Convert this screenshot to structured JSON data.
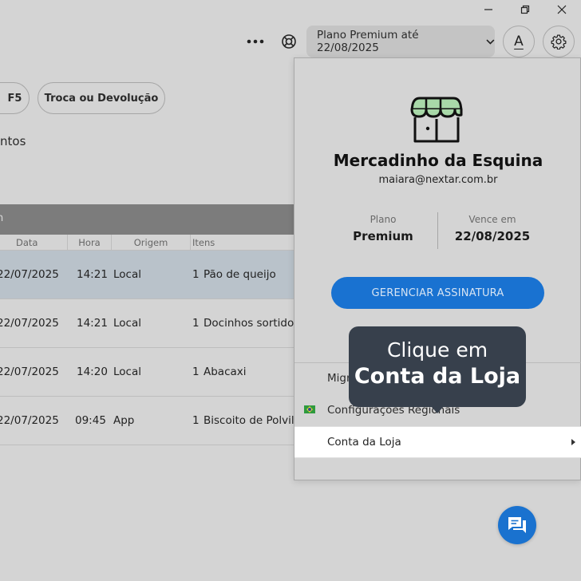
{
  "toolbar": {
    "plan_label": "Plano Premium até 22/08/2025",
    "text_size_label": "A"
  },
  "actions": {
    "f5_label": "F5",
    "exchange_label": "Troca ou Devolução"
  },
  "partial_text": "ntos",
  "table": {
    "title_fragment": "n",
    "headers": [
      "Data",
      "Hora",
      "Origem",
      "Itens"
    ],
    "rows": [
      {
        "date": "22/07/2025",
        "time": "14:21",
        "origin": "Local",
        "qty": "1",
        "item": "Pão de queijo"
      },
      {
        "date": "22/07/2025",
        "time": "14:21",
        "origin": "Local",
        "qty": "1",
        "item": "Docinhos sortidos"
      },
      {
        "date": "22/07/2025",
        "time": "14:20",
        "origin": "Local",
        "qty": "1",
        "item": "Abacaxi"
      },
      {
        "date": "22/07/2025",
        "time": "09:45",
        "origin": "App",
        "qty": "1",
        "item": "Biscoito de Polvilho"
      }
    ]
  },
  "panel": {
    "store_name": "Mercadinho da Esquina",
    "email": "maiara@nextar.com.br",
    "plan_label": "Plano",
    "plan_value": "Premium",
    "expires_label": "Vence em",
    "expires_value": "22/08/2025",
    "manage_button": "GERENCIAR ASSINATURA",
    "menu": {
      "migrate_fragment": "Migr",
      "regional_settings": "Configurações Regionais",
      "store_account": "Conta da Loja"
    }
  },
  "tooltip": {
    "line1": "Clique em",
    "line2": "Conta da Loja"
  },
  "colors": {
    "accent": "#1972d1",
    "tooltip_bg": "#37404c",
    "store_awning": "#a8d8a8"
  }
}
